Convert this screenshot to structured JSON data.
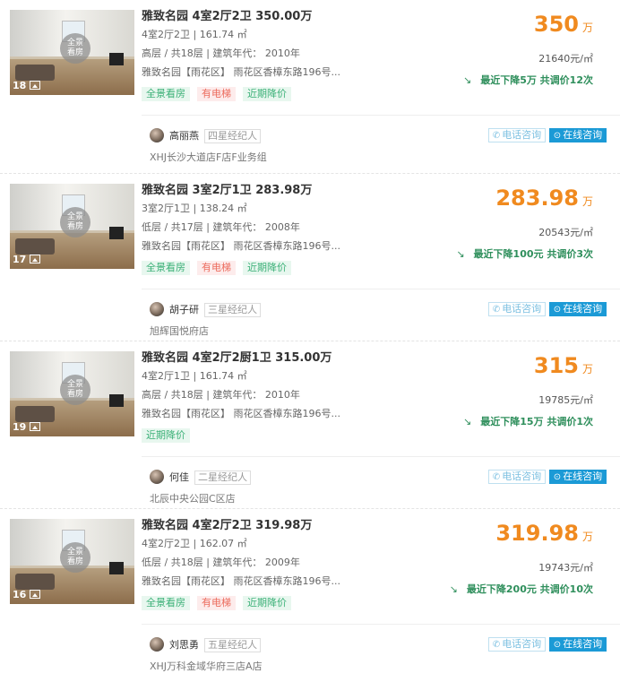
{
  "panorama_label": "全景\n看房",
  "price_unit": "万",
  "listings": [
    {
      "photo_count": "18",
      "title": "雅致名园 4室2厅2卫 350.00万",
      "layout": "4室2厅2卫 | 161.74 ㎡",
      "floor": "高层 / 共18层 | 建筑年代： 2010年",
      "address": "雅致名园【雨花区】 雨花区香樟东路196号...",
      "tags": [
        {
          "text": "全景看房",
          "style": "green"
        },
        {
          "text": "有电梯",
          "style": "red"
        },
        {
          "text": "近期降价",
          "style": "green"
        }
      ],
      "price": "350",
      "unit_price": "21640元/㎡",
      "price_change": "最近下降5万  共调价12次",
      "agent_name": "高丽燕",
      "agent_level": "四星经纪人",
      "store": "XHJ长沙大道店F店F业务组",
      "call_label": "电话咨询",
      "chat_label": "在线咨询"
    },
    {
      "photo_count": "17",
      "title": "雅致名园 3室2厅1卫 283.98万",
      "layout": "3室2厅1卫 | 138.24 ㎡",
      "floor": "低层 / 共17层 | 建筑年代： 2008年",
      "address": "雅致名园【雨花区】 雨花区香樟东路196号...",
      "tags": [
        {
          "text": "全景看房",
          "style": "green"
        },
        {
          "text": "有电梯",
          "style": "red"
        },
        {
          "text": "近期降价",
          "style": "green"
        }
      ],
      "price": "283.98",
      "unit_price": "20543元/㎡",
      "price_change": "最近下降100元  共调价3次",
      "agent_name": "胡子研",
      "agent_level": "三星经纪人",
      "store": "旭辉国悦府店",
      "call_label": "电话咨询",
      "chat_label": "在线咨询"
    },
    {
      "photo_count": "19",
      "title": "雅致名园 4室2厅2厨1卫 315.00万",
      "layout": "4室2厅1卫 | 161.74 ㎡",
      "floor": "高层 / 共18层 | 建筑年代： 2010年",
      "address": "雅致名园【雨花区】 雨花区香樟东路196号...",
      "tags": [
        {
          "text": "近期降价",
          "style": "green"
        }
      ],
      "price": "315",
      "unit_price": "19785元/㎡",
      "price_change": "最近下降15万  共调价1次",
      "agent_name": "何佳",
      "agent_level": "二星经纪人",
      "store": "北辰中央公园C区店",
      "call_label": "电话咨询",
      "chat_label": "在线咨询"
    },
    {
      "photo_count": "16",
      "title": "雅致名园 4室2厅2卫 319.98万",
      "layout": "4室2厅2卫 | 162.07 ㎡",
      "floor": "低层 / 共18层 | 建筑年代： 2009年",
      "address": "雅致名园【雨花区】 雨花区香樟东路196号...",
      "tags": [
        {
          "text": "全景看房",
          "style": "green"
        },
        {
          "text": "有电梯",
          "style": "red"
        },
        {
          "text": "近期降价",
          "style": "green"
        }
      ],
      "price": "319.98",
      "unit_price": "19743元/㎡",
      "price_change": "最近下降200元  共调价10次",
      "agent_name": "刘思勇",
      "agent_level": "五星经纪人",
      "store": "XHJ万科金域华府三店A店",
      "call_label": "电话咨询",
      "chat_label": "在线咨询"
    }
  ]
}
